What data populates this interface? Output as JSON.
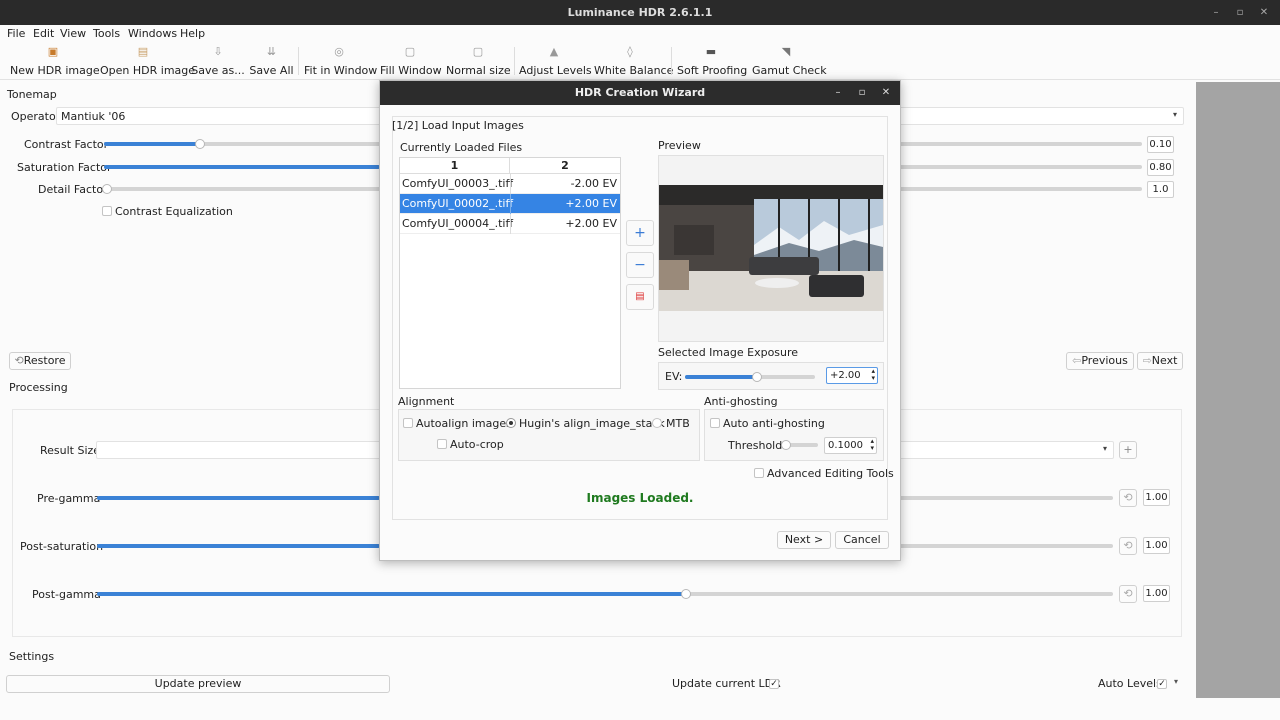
{
  "app": {
    "title": "Luminance HDR 2.6.1.1"
  },
  "menu": [
    "File",
    "Edit",
    "View",
    "Tools",
    "Windows",
    "Help"
  ],
  "toolbar": [
    {
      "label": "New HDR image",
      "icon": "new-hdr-icon"
    },
    {
      "label": "Open HDR image",
      "icon": "open-icon"
    },
    {
      "label": "Save as...",
      "icon": "save-as-icon"
    },
    {
      "label": "Save All",
      "icon": "save-all-icon"
    },
    {
      "label": "Fit in Window",
      "icon": "zoom-fit-icon"
    },
    {
      "label": "Fill Window",
      "icon": "fill-window-icon"
    },
    {
      "label": "Normal size",
      "icon": "normal-size-icon"
    },
    {
      "label": "Adjust Levels",
      "icon": "levels-icon"
    },
    {
      "label": "White Balance",
      "icon": "white-balance-icon"
    },
    {
      "label": "Soft Proofing",
      "icon": "soft-proofing-icon"
    },
    {
      "label": "Gamut Check",
      "icon": "gamut-check-icon"
    }
  ],
  "tonemap": {
    "header": "Tonemap",
    "operator_label": "Operator",
    "operator_value": "Mantiuk '06",
    "contrast_label": "Contrast Factor",
    "contrast_value": "0.10",
    "contrast_level": 0.1,
    "saturation_label": "Saturation Factor",
    "saturation_value": "0.80",
    "detail_label": "Detail Factor",
    "detail_value": "1.0",
    "equalization_label": "Contrast Equalization",
    "restore": "Restore",
    "previous": "Previous",
    "next": "Next"
  },
  "processing": {
    "header": "Processing",
    "result_size_label": "Result Size",
    "pregamma_label": "Pre-gamma",
    "pregamma_value": "1.00",
    "postsat_label": "Post-saturation",
    "postsat_value": "1.00",
    "postgamma_label": "Post-gamma",
    "postgamma_value": "1.00",
    "add_symbol": "+",
    "reset_symbol": "⟲"
  },
  "settings": {
    "header": "Settings",
    "update_preview": "Update preview",
    "update_ldr": "Update current LDR",
    "auto_levels": "Auto Levels",
    "check": "✓"
  },
  "wizard": {
    "title": "HDR Creation Wizard",
    "step": "[1/2] Load Input Images",
    "loaded_label": "Currently Loaded Files",
    "col1": "1",
    "col2": "2",
    "files": [
      {
        "name": "ComfyUI_00003_.tiff",
        "ev": "-2.00 EV",
        "selected": false
      },
      {
        "name": "ComfyUI_00002_.tiff",
        "ev": "+2.00 EV",
        "selected": true
      },
      {
        "name": "ComfyUI_00004_.tiff",
        "ev": "+2.00 EV",
        "selected": false
      }
    ],
    "preview_label": "Preview",
    "exposure_label": "Selected Image Exposure",
    "ev_label": "EV:",
    "ev_value": "+2.00",
    "alignment_label": "Alignment",
    "autoalign": "Autoalign images",
    "hugin": "Hugin's align_image_stack",
    "mtb": "MTB",
    "autocrop": "Auto-crop",
    "antighost_label": "Anti-ghosting",
    "auto_antighost": "Auto anti-ghosting",
    "threshold_label": "Threshold",
    "threshold_value": "0.1000",
    "advanced": "Advanced Editing Tools",
    "status": "Images Loaded.",
    "next": "Next >",
    "cancel": "Cancel",
    "status_color": "#1f7a1f",
    "accent": "#3584e4"
  }
}
